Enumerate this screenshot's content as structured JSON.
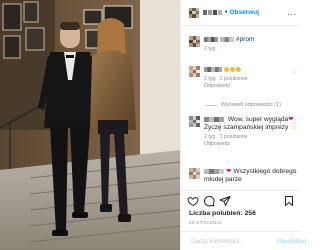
{
  "colors": {
    "accent": "#0095f6",
    "muted": "#8e8e8e",
    "text": "#262626",
    "border": "#efefef",
    "heart": "#e0245e"
  },
  "post": {
    "image_alt": "",
    "icon": "photo"
  },
  "header": {
    "follow": "Obserwuj",
    "separator": "•",
    "more_icon": "more-horizontal-icon",
    "more": "..."
  },
  "caption": {
    "hashtag": "#prom",
    "time": "2 tyg."
  },
  "comments": [
    {
      "text": "",
      "time": "2 tyg.",
      "likes": "1 polubienie",
      "reply": "Odpowiedz",
      "emoji": "sunglasses-emoji-x3"
    },
    {
      "text_a": "Wow, super wygląda",
      "text_b": "Życzę szampańskiej imprezy",
      "time": "2 tyg.",
      "likes": "1 polubienie",
      "reply": "Odpowiedz",
      "emoji": "heart-emoji, smile-emoji"
    },
    {
      "text": "Wszystkiego dobrego młodej parze",
      "time": "",
      "emoji": "heart-emoji"
    }
  ],
  "view_replies": "Wyświetl odpowiedzi (1)",
  "actions": {
    "like_icon": "heart-icon",
    "comment_icon": "comment-icon",
    "share_icon": "paper-plane-icon",
    "save_icon": "bookmark-icon"
  },
  "likes_label": "Liczba polubień: 256",
  "date": "20 STYCZNIA",
  "add_comment": {
    "placeholder": "Dodaj komentarz...",
    "publish": "Opublikuj"
  }
}
